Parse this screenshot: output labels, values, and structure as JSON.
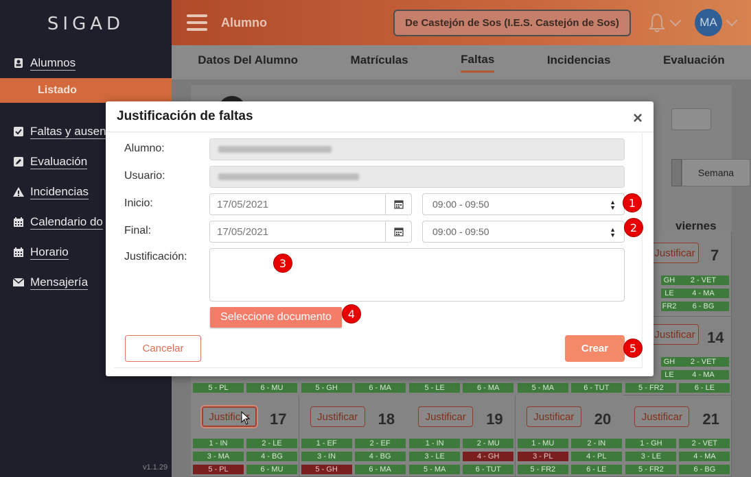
{
  "sidebar": {
    "brand": "SIGAD",
    "items": [
      {
        "label": "Alumnos",
        "icon": "student-icon"
      },
      {
        "label": "Faltas y ausen",
        "icon": "checkbox-icon"
      },
      {
        "label": "Evaluación",
        "icon": "edit-icon"
      },
      {
        "label": "Incidencias",
        "icon": "warning-icon"
      },
      {
        "label": "Calendario do",
        "icon": "calendar-icon"
      },
      {
        "label": "Horario",
        "icon": "calendar-icon"
      },
      {
        "label": "Mensajería",
        "icon": "mail-icon"
      }
    ],
    "sub_item": "Listado",
    "version": "v1.1.29"
  },
  "topbar": {
    "title": "Alumno",
    "school": "De Castejón de Sos (I.E.S. Castejón de Sos)",
    "avatar": "MA"
  },
  "tabs": [
    "Datos Del Alumno",
    "Matrículas",
    "Faltas",
    "Incidencias",
    "Evaluación"
  ],
  "active_tab": "Faltas",
  "background": {
    "semana": "Semana",
    "viernes": "viernes",
    "justificar": "Justificar",
    "days_row1": [
      "7"
    ],
    "days_row2": [
      "14"
    ],
    "days_row3": [
      "17",
      "18",
      "19",
      "20",
      "21"
    ],
    "row1_slots": [
      "GH",
      "2 - VET",
      "LE",
      "4 - MA",
      "FR2",
      "6 - BG"
    ],
    "row2_slots_top": [
      "GH",
      "2 - VET",
      "LE",
      "4 - MA"
    ],
    "row2_slots": [
      "5 - PL",
      "6 - MU",
      "5 - GH",
      "6 - MA",
      "5 - LE",
      "6 - MA",
      "5 - MA",
      "6 - TUT",
      "5 - FR2",
      "6 - LE",
      "5 - FR2",
      "6 - BG"
    ],
    "row2_partial": [
      "5 - MA",
      "4 - BG",
      "3 - IN",
      "4 - BG",
      "3 - LE",
      "4 - GH",
      "3 - PL",
      "4 - PL",
      "3 - LE",
      "4 - MA"
    ],
    "row3_slots": [
      [
        "1 - IN",
        "2 - LE",
        "3 - MA",
        "4 - BG",
        "5 - PL",
        "6 - MU"
      ],
      [
        "1 - EF",
        "2 - EF",
        "3 - IN",
        "4 - BG",
        "5 - GH",
        "6 - MA"
      ],
      [
        "1 - IN",
        "2 - MU",
        "3 - LE",
        "4 - GH",
        "5 - MA",
        "6 - TUT"
      ],
      [
        "1 - MU",
        "2 - IN",
        "3 - PL",
        "4 - PL",
        "5 - FR2",
        "6 - LE"
      ],
      [
        "1 - GH",
        "2 - VET",
        "3 - LE",
        "4 - MA",
        "5 - FR2",
        "6 - BG"
      ]
    ]
  },
  "modal": {
    "title": "Justificación de faltas",
    "close": "×",
    "labels": {
      "alumno": "Alumno:",
      "usuario": "Usuario:",
      "inicio": "Inicio:",
      "final": "Final:",
      "justificacion": "Justificación:"
    },
    "inicio_date": "17/05/2021",
    "final_date": "17/05/2021",
    "inicio_time": "09:00 - 09:50",
    "final_time": "09:00 - 09:50",
    "justificacion_value": "",
    "doc_button": "Seleccione documento",
    "cancel": "Cancelar",
    "crear": "Crear"
  },
  "badges": [
    "1",
    "2",
    "3",
    "4",
    "5"
  ]
}
